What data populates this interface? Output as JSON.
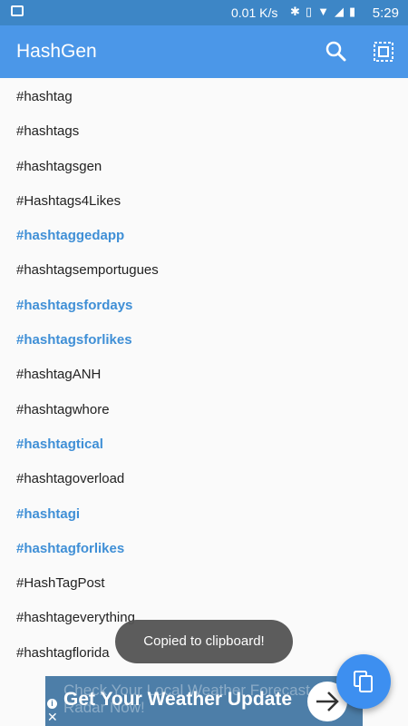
{
  "status_bar": {
    "network_speed": "0.01 K/s",
    "battery": "",
    "time": "5:29",
    "icons": [
      "image-icon",
      "bluetooth-icon",
      "vibrate-icon",
      "wifi-icon",
      "signal-icon",
      "battery-icon"
    ]
  },
  "app_bar": {
    "title": "HashGen",
    "actions": [
      "search-icon",
      "select-all-icon"
    ]
  },
  "hashtags": [
    {
      "text": "#hashtag",
      "selected": false
    },
    {
      "text": "#hashtags",
      "selected": false
    },
    {
      "text": "#hashtagsgen",
      "selected": false
    },
    {
      "text": "#Hashtags4Likes",
      "selected": false
    },
    {
      "text": "#hashtaggedapp",
      "selected": true
    },
    {
      "text": "#hashtagsemportugues",
      "selected": false
    },
    {
      "text": "#hashtagsfordays",
      "selected": true
    },
    {
      "text": "#hashtagsforlikes",
      "selected": true
    },
    {
      "text": "#hashtagANH",
      "selected": false
    },
    {
      "text": "#hashtagwhore",
      "selected": false
    },
    {
      "text": "#hashtagtical",
      "selected": true
    },
    {
      "text": "#hashtagoverload",
      "selected": false
    },
    {
      "text": "#hashtagi",
      "selected": true
    },
    {
      "text": "#hashtagforlikes",
      "selected": true
    },
    {
      "text": "#HashTagPost",
      "selected": false
    },
    {
      "text": "#hashtageverything",
      "selected": false
    },
    {
      "text": "#hashtagflorida",
      "selected": false
    }
  ],
  "toast": {
    "message": "Copied to clipboard!"
  },
  "fab": {
    "icon": "copy-icon"
  },
  "ad": {
    "ghost_text": "Check Your Local Weather Forecast & Radar Now!",
    "headline": "Get Your Weather Update",
    "icons": [
      "info-icon",
      "close-icon",
      "arrow-right-icon"
    ]
  },
  "colors": {
    "status_bar": "#3d86c6",
    "app_bar": "#4b97e8",
    "selected_text": "#3f8fd6",
    "fab": "#3d8ff0",
    "toast": "#545454",
    "ad_background": "#4d7ea8"
  }
}
